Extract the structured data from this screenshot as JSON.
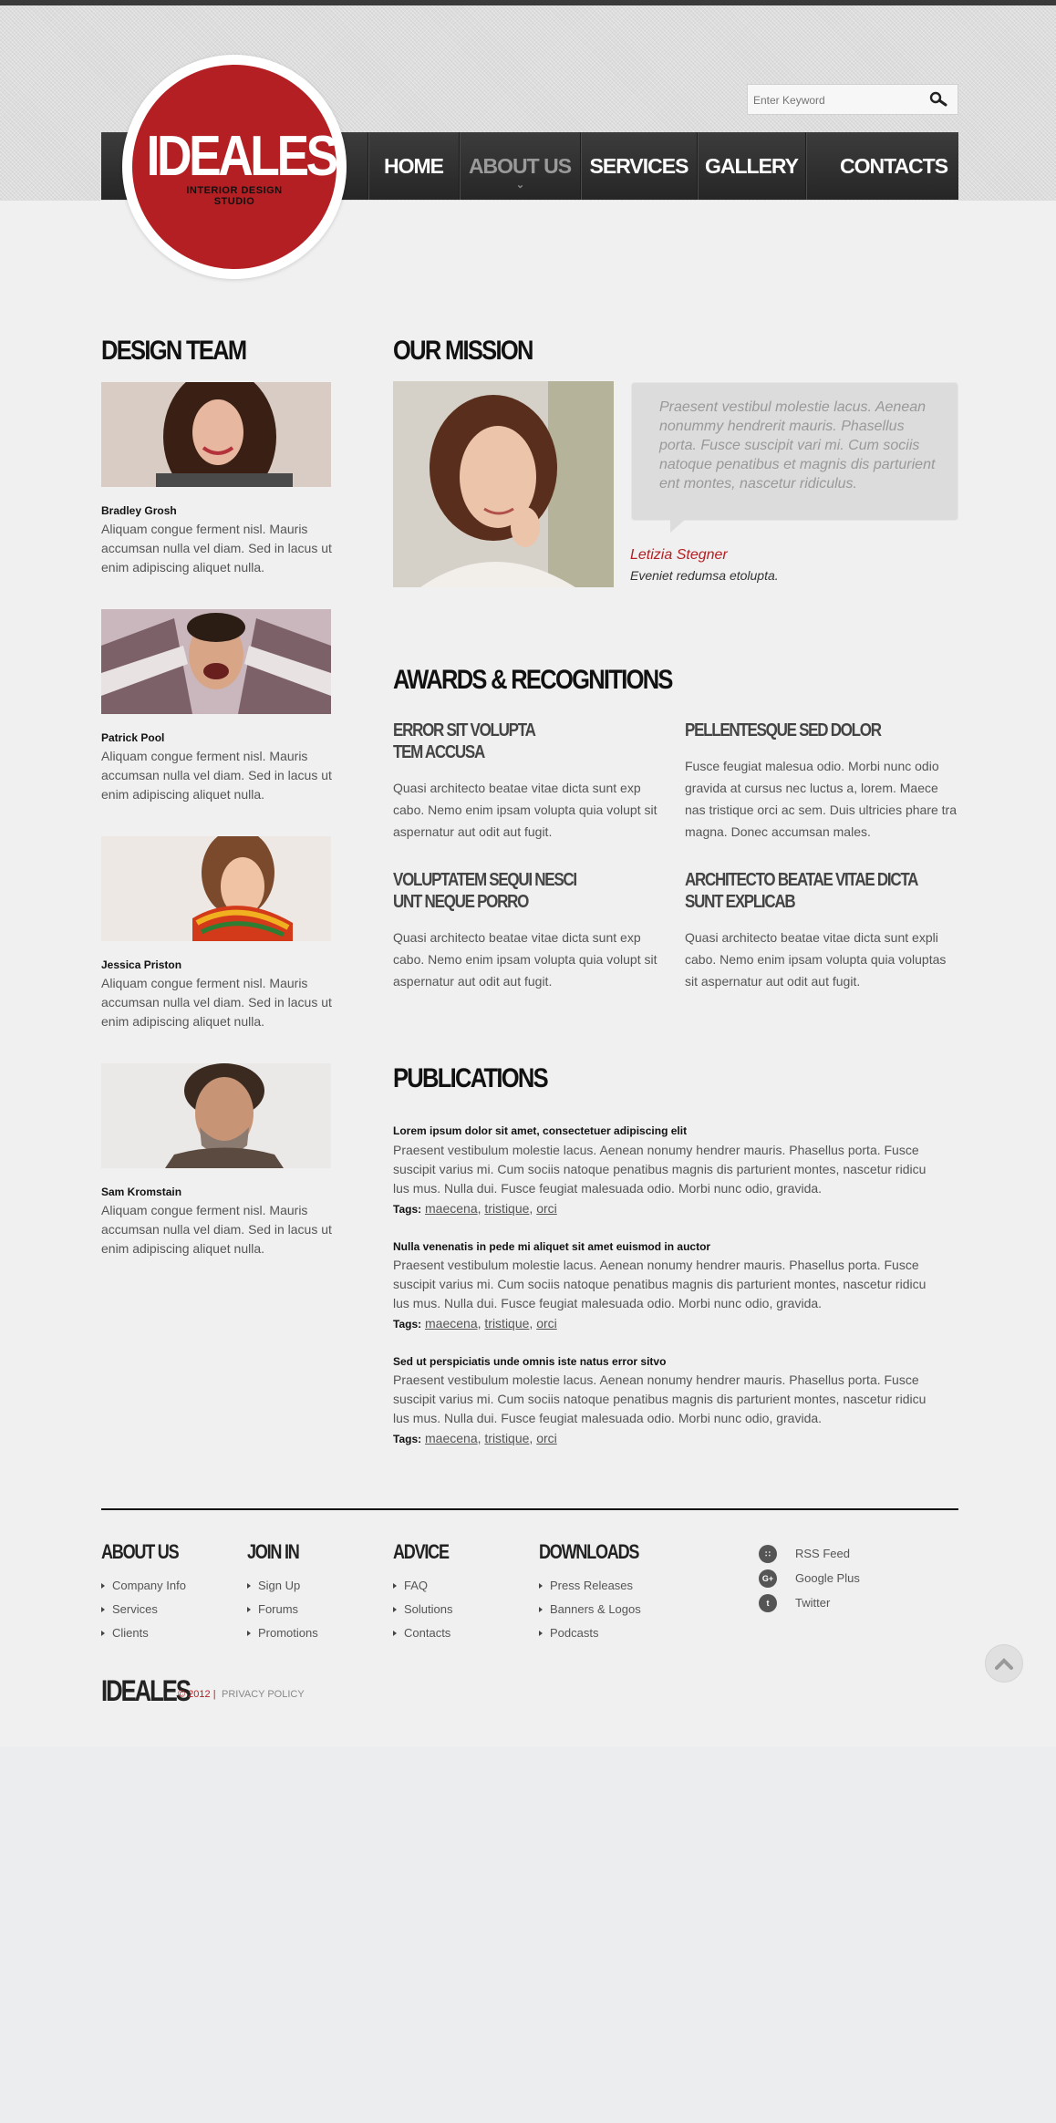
{
  "brand": {
    "logo_title": "IDEALES",
    "logo_subtitle_line1": "INTERIOR DESIGN",
    "logo_subtitle_line2": "STUDIO",
    "accent": "#b41f23"
  },
  "search": {
    "placeholder": "Enter Keyword",
    "icon": "search-icon"
  },
  "nav": [
    {
      "label": "HOME"
    },
    {
      "label": "ABOUT US",
      "active": true
    },
    {
      "label": "SERVICES"
    },
    {
      "label": "GALLERY"
    },
    {
      "label": "CONTACTS"
    }
  ],
  "design_team": {
    "heading": "DESIGN TEAM",
    "members": [
      {
        "name": "Bradley Grosh",
        "desc": "Aliquam congue ferment nisl. Mauris accumsan nulla vel diam. Sed in lacus ut enim adipiscing aliquet nulla."
      },
      {
        "name": "Patrick Pool",
        "desc": "Aliquam congue ferment nisl. Mauris accumsan nulla vel diam. Sed in lacus ut enim adipiscing aliquet nulla."
      },
      {
        "name": "Jessica Priston",
        "desc": "Aliquam congue ferment nisl. Mauris accumsan nulla vel diam. Sed in lacus ut enim adipiscing aliquet nulla."
      },
      {
        "name": "Sam Kromstain",
        "desc": "Aliquam congue ferment nisl. Mauris accumsan nulla vel diam. Sed in lacus ut enim adipiscing aliquet nulla."
      }
    ]
  },
  "mission": {
    "heading": "OUR MISSION",
    "quote": "Praesent vestibul molestie lacus. Aenean nonummy hendrerit mauris. Phasellus porta. Fusce suscipit vari mi. Cum sociis natoque penatibus et magnis dis parturient ent montes, nascetur ridiculus.",
    "author": "Letizia Stegner",
    "role": "Eveniet redumsa etolupta."
  },
  "awards": {
    "heading": "AWARDS & RECOGNITIONS",
    "items": [
      {
        "title1": "ERROR SIT VOLUPTA",
        "title2": "TEM ACCUSA",
        "text": "Quasi architecto beatae vitae dicta sunt exp cabo. Nemo enim ipsam volupta quia volupt sit aspernatur aut odit aut fugit."
      },
      {
        "title1": "PELLENTESQUE SED DOLOR",
        "title2": "",
        "text": "Fusce feugiat malesua odio. Morbi nunc odio gravida at cursus nec luctus a, lorem. Maece nas tristique orci ac sem. Duis ultricies phare tra magna. Donec accumsan males."
      },
      {
        "title1": "VOLUPTATEM SEQUI NESCI",
        "title2": "UNT NEQUE PORRO",
        "text": "Quasi architecto beatae vitae dicta sunt exp cabo. Nemo enim ipsam volupta quia volupt sit aspernatur aut odit aut fugit."
      },
      {
        "title1": "ARCHITECTO BEATAE VITAE DICTA",
        "title2": "SUNT EXPLICAB",
        "text": "Quasi architecto beatae vitae dicta sunt expli cabo. Nemo enim ipsam volupta quia voluptas sit aspernatur aut odit aut fugit."
      }
    ]
  },
  "publications": {
    "heading": "PUBLICATIONS",
    "tags_label": "Tags:",
    "items": [
      {
        "title": "Lorem ipsum dolor sit amet, consectetuer adipiscing elit",
        "text": "Praesent vestibulum molestie lacus. Aenean nonumy hendrer mauris. Phasellus porta. Fusce suscipit varius mi. Cum sociis natoque penatibus magnis dis parturient montes, nascetur ridicu lus mus. Nulla dui. Fusce feugiat malesuada odio. Morbi nunc odio, gravida.",
        "tags": [
          "maecena",
          "tristique",
          "orci"
        ]
      },
      {
        "title": "Nulla venenatis in pede mi aliquet sit amet euismod in auctor",
        "text": "Praesent vestibulum molestie lacus. Aenean nonumy hendrer mauris. Phasellus porta. Fusce suscipit varius mi. Cum sociis natoque penatibus magnis dis parturient montes, nascetur ridicu lus mus. Nulla dui. Fusce feugiat malesuada odio. Morbi nunc odio, gravida.",
        "tags": [
          "maecena",
          "tristique",
          "orci"
        ]
      },
      {
        "title": "Sed ut perspiciatis unde omnis iste natus error sitvo",
        "text": "Praesent vestibulum molestie lacus. Aenean nonumy hendrer mauris. Phasellus porta. Fusce suscipit varius mi. Cum sociis natoque penatibus magnis dis parturient montes, nascetur ridicu lus mus. Nulla dui. Fusce feugiat malesuada odio. Morbi nunc odio, gravida.",
        "tags": [
          "maecena",
          "tristique",
          "orci"
        ]
      }
    ]
  },
  "footer": {
    "columns": [
      {
        "title": "ABOUT US",
        "links": [
          "Company Info",
          "Services",
          "Clients"
        ]
      },
      {
        "title": "JOIN IN",
        "links": [
          "Sign Up",
          "Forums",
          "Promotions"
        ]
      },
      {
        "title": "ADVICE",
        "links": [
          "FAQ",
          "Solutions",
          "Contacts"
        ]
      },
      {
        "title": "DOWNLOADS",
        "links": [
          "Press Releases",
          "Banners & Logos",
          "Podcasts"
        ]
      }
    ],
    "social": [
      {
        "label": "RSS Feed",
        "icon": "rss-icon"
      },
      {
        "label": "Google Plus",
        "icon": "google-plus-icon"
      },
      {
        "label": "Twitter",
        "icon": "twitter-icon"
      }
    ],
    "logo": "IDEALES",
    "copyright": "© 2012 |",
    "privacy": "PRIVACY POLICY"
  }
}
